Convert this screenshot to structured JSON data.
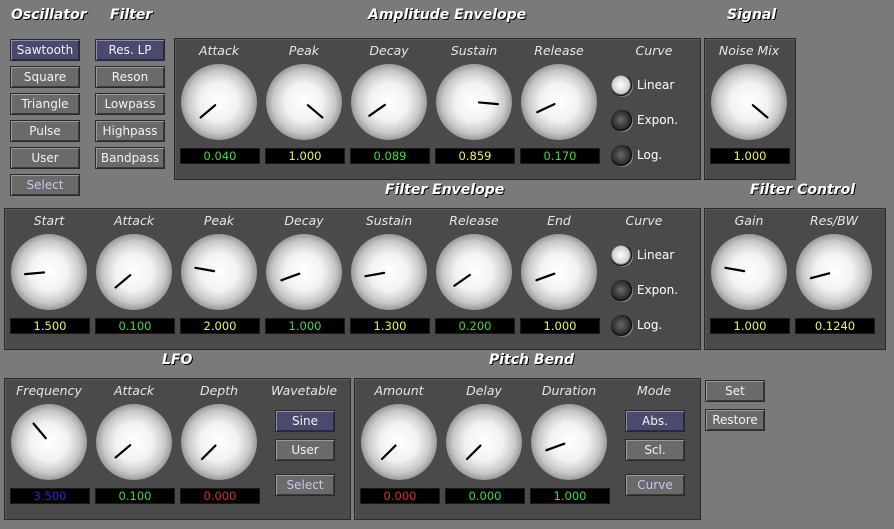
{
  "headers": {
    "oscillator": "Oscillator",
    "filter": "Filter",
    "amplitude_envelope": "Amplitude Envelope",
    "signal": "Signal",
    "filter_envelope": "Filter Envelope",
    "filter_control": "Filter Control",
    "lfo": "LFO",
    "pitch_bend": "Pitch Bend"
  },
  "oscillator": [
    "Sawtooth",
    "Square",
    "Triangle",
    "Pulse",
    "User",
    "Select"
  ],
  "filter": [
    "Res. LP",
    "Reson",
    "Lowpass",
    "Highpass",
    "Bandpass"
  ],
  "curve_label": "Curve",
  "curve_options": [
    "Linear",
    "Expon.",
    "Log."
  ],
  "amp_env": {
    "knobs": [
      {
        "label": "Attack",
        "value": "0.040",
        "color": "#3cdc3c",
        "angle": -130
      },
      {
        "label": "Peak",
        "value": "1.000",
        "color": "#f0f060",
        "angle": 130
      },
      {
        "label": "Decay",
        "value": "0.089",
        "color": "#3cdc3c",
        "angle": -125
      },
      {
        "label": "Sustain",
        "value": "0.859",
        "color": "#f0f060",
        "angle": 95
      },
      {
        "label": "Release",
        "value": "0.170",
        "color": "#3cdc3c",
        "angle": -115
      }
    ],
    "curve_selected": 0
  },
  "signal": {
    "knobs": [
      {
        "label": "Noise Mix",
        "value": "1.000",
        "color": "#f0f060",
        "angle": 130
      }
    ]
  },
  "filter_env": {
    "knobs": [
      {
        "label": "Start",
        "value": "1.500",
        "color": "#f0f060",
        "angle": -95
      },
      {
        "label": "Attack",
        "value": "0.100",
        "color": "#3cdc3c",
        "angle": -130
      },
      {
        "label": "Peak",
        "value": "2.000",
        "color": "#f0f060",
        "angle": -80
      },
      {
        "label": "Decay",
        "value": "1.000",
        "color": "#3cdc3c",
        "angle": -110
      },
      {
        "label": "Sustain",
        "value": "1.300",
        "color": "#f0f060",
        "angle": -100
      },
      {
        "label": "Release",
        "value": "0.200",
        "color": "#3cdc3c",
        "angle": -125
      },
      {
        "label": "End",
        "value": "1.000",
        "color": "#f0f060",
        "angle": -110
      }
    ],
    "curve_selected": 0
  },
  "filter_control": {
    "knobs": [
      {
        "label": "Gain",
        "value": "1.000",
        "color": "#f0f060",
        "angle": -80
      },
      {
        "label": "Res/BW",
        "value": "0.1240",
        "color": "#f0f060",
        "angle": -105
      }
    ]
  },
  "lfo": {
    "knobs": [
      {
        "label": "Frequency",
        "value": "3.500",
        "color": "#2828dc",
        "angle": -40
      },
      {
        "label": "Attack",
        "value": "0.100",
        "color": "#3cdc3c",
        "angle": -130
      },
      {
        "label": "Depth",
        "value": "0.000",
        "color": "#e02828",
        "angle": -135
      }
    ],
    "wavetable_label": "Wavetable",
    "wavetable": [
      "Sine",
      "User",
      "Select"
    ]
  },
  "pitch_bend": {
    "knobs": [
      {
        "label": "Amount",
        "value": "0.000",
        "color": "#e02828",
        "angle": -135
      },
      {
        "label": "Delay",
        "value": "0.000",
        "color": "#3cdc3c",
        "angle": -135
      },
      {
        "label": "Duration",
        "value": "1.000",
        "color": "#3cdc3c",
        "angle": -110
      }
    ],
    "mode_label": "Mode",
    "mode": [
      "Abs.",
      "Scl.",
      "Curve"
    ]
  },
  "actions": [
    "Set",
    "Restore"
  ]
}
